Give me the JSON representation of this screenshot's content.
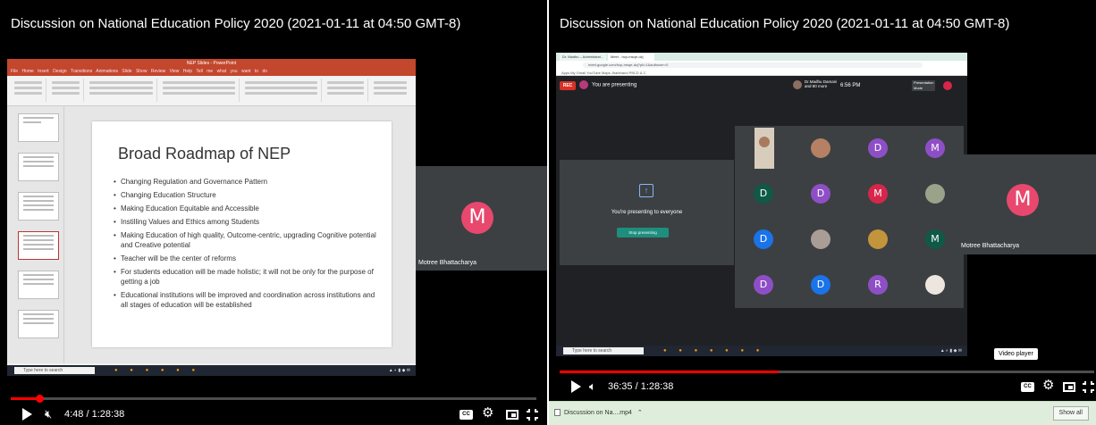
{
  "colors": {
    "red": "#ff0000",
    "avatar_pink": "#e8486e",
    "avatar_purple": "#8e4fc6",
    "avatar_blue": "#1a73e8",
    "avatar_green": "#0f5947",
    "avatar_red": "#d7264b",
    "teal": "#1e8e7e"
  },
  "left_video": {
    "title": "Discussion on National Education Policy 2020 (2021-01-11 at 04:50 GMT-8)",
    "time": "4:48 / 1:28:38",
    "progress_fraction": 0.054,
    "participant": {
      "initial": "M",
      "name": "Motree Bhattacharya"
    },
    "ppt": {
      "window_title": "NEP Slides - PowerPoint",
      "tabs": "File Home Insert Design Transitions Animations Slide Show Review View Help Tell me what you want to do",
      "taskbar_search": "Type here to search",
      "slide": {
        "title": "Broad Roadmap of NEP",
        "bullets": [
          "Changing Regulation and Governance Pattern",
          "Changing Education Structure",
          "Making Education Equitable and Accessible",
          "Instilling Values and Ethics among Students",
          "Making Education of high quality, Outcome-centric, upgrading Cognitive potential and Creative potential",
          "Teacher will be the center of reforms",
          "For students education will be made holistic; it will not be only for the purpose of getting a job",
          "Educational institutions will be improved and coordination across institutions and all stages of education will be established"
        ]
      }
    },
    "icons": {
      "play": "play-icon",
      "mute": "muted-volume-icon",
      "cc": "CC",
      "settings": "gear-icon",
      "miniplayer": "miniplayer-icon",
      "fullscreen": "fullscreen-icon"
    }
  },
  "right_video": {
    "title": "Discussion on National Education Policy 2020 (2021-01-11 at 04:50 GMT-8)",
    "time": "36:35 / 1:28:38",
    "progress_fraction": 0.41,
    "participant": {
      "initial": "M",
      "name": "Motree Bhattacharya"
    },
    "tooltip": "Video player",
    "meet": {
      "tabs": [
        "Meet - hcp-msqe-dzj",
        "Dr. Madhu – Administrat..."
      ],
      "url": "meet.google.com/hcp-msqe-dzj?pli=1&authuser=0",
      "bookmarks": "Apps  My Gmail  YouTube  Maps  Jharkhand PBCD & C",
      "rec": "REC",
      "presenting_label": "You are presenting",
      "host": "Dr.Madhu Damani and 80 more",
      "clock": "6:56 PM",
      "presentation_btn": "Presentation Mode",
      "box_message": "You're presenting to everyone",
      "stop_button": "Stop presenting",
      "taskbar_search": "Type here to search",
      "grid": [
        [
          "photo",
          "photo",
          "D",
          "M"
        ],
        [
          "D",
          "D",
          "M",
          "photo"
        ],
        [
          "D",
          "photo",
          "photo",
          "M"
        ],
        [
          "D",
          "D",
          "R",
          "photo"
        ]
      ]
    },
    "icons": {
      "play": "play-icon",
      "volume": "volume-icon",
      "cc": "CC",
      "settings": "gear-icon",
      "miniplayer": "miniplayer-icon",
      "fullscreen": "fullscreen-icon"
    }
  },
  "download_bar": {
    "file": "Discussion on Na....mp4",
    "show_all": "Show all"
  }
}
